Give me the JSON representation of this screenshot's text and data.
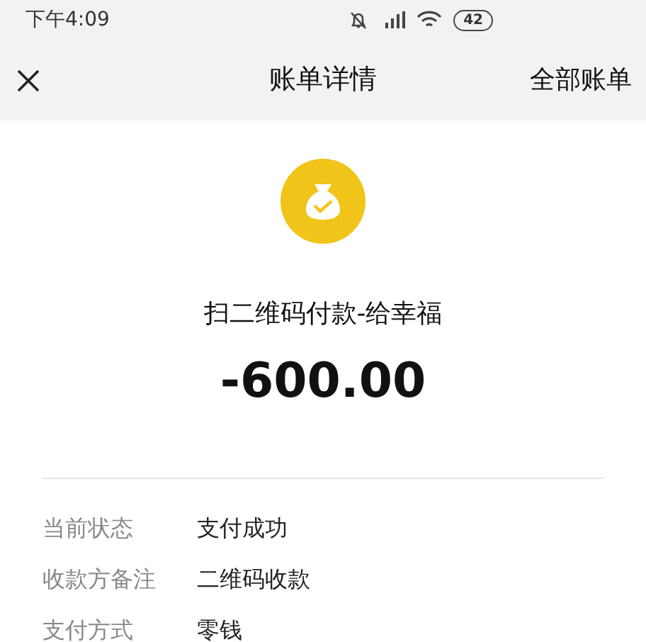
{
  "status_bar": {
    "time": "下午4:09",
    "battery": "42"
  },
  "header": {
    "title": "账单详情",
    "action": "全部账单"
  },
  "payment": {
    "title": "扫二维码付款-给幸福",
    "amount": "-600.00"
  },
  "details": [
    {
      "label": "当前状态",
      "value": "支付成功"
    },
    {
      "label": "收款方备注",
      "value": "二维码收款"
    },
    {
      "label": "支付方式",
      "value": "零钱"
    }
  ]
}
